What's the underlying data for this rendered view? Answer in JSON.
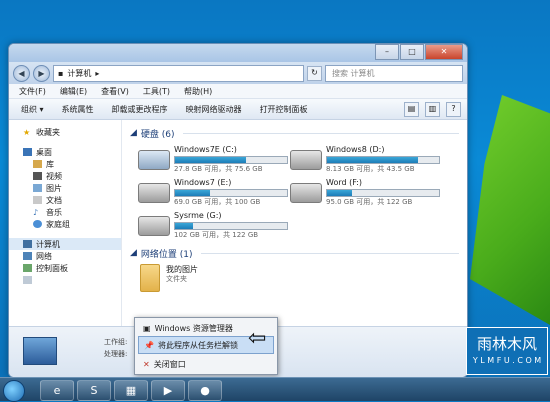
{
  "address": {
    "path": "计算机",
    "search_placeholder": "搜索 计算机"
  },
  "menu": [
    "文件(F)",
    "编辑(E)",
    "查看(V)",
    "工具(T)",
    "帮助(H)"
  ],
  "toolbar": [
    "组织 ▾",
    "系统属性",
    "卸载或更改程序",
    "映射网络驱动器",
    "打开控制面板"
  ],
  "nav": {
    "favorites": "收藏夹",
    "desktop": "桌面",
    "library": "库",
    "videos": "视频",
    "pictures": "图片",
    "documents": "文档",
    "music": "音乐",
    "homegroup": "家庭组",
    "computer": "计算机",
    "network": "网络",
    "control_panel": "控制面板"
  },
  "content": {
    "drives_header": "硬盘 (6)",
    "network_header": "网络位置 (1)",
    "drives": [
      {
        "name": "Windows7E (C:)",
        "info": "27.8 GB 可用，共 75.6 GB",
        "used_fraction": 0.63
      },
      {
        "name": "Windows8 (D:)",
        "info": "8.13 GB 可用，共 43.5 GB",
        "used_fraction": 0.81
      },
      {
        "name": "Windows7 (E:)",
        "info": "69.0 GB 可用，共 100 GB",
        "used_fraction": 0.31
      },
      {
        "name": "Word (F:)",
        "info": "95.0 GB 可用，共 122 GB",
        "used_fraction": 0.22
      },
      {
        "name": "Sysrme (G:)",
        "info": "102 GB 可用，共 122 GB",
        "used_fraction": 0.16
      }
    ],
    "network_item": {
      "name": "我的图片",
      "type": "文件夹"
    }
  },
  "details": {
    "workgroup": "工作组:",
    "processor": "处理器:"
  },
  "jumplist": {
    "item1": "Windows 资源管理器",
    "item2": "将此程序从任务栏解锁",
    "item3": "关闭窗口"
  },
  "watermark": {
    "line1": "雨林木风",
    "line2": "Y L M F U . C O M"
  }
}
